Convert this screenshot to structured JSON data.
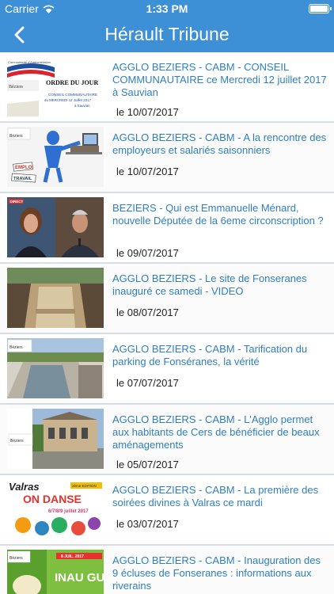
{
  "status_bar": {
    "carrier": "Carrier",
    "time": "1:33 PM"
  },
  "nav": {
    "title": "Hérault Tribune"
  },
  "articles": [
    {
      "headline": "AGGLO BEZIERS - CABM - CONSEIL COMMUNAUTAIRE ce Mercredi 12 juillet 2017 à Sauvian",
      "date": "le 10/07/2017"
    },
    {
      "headline": "AGGLO BEZIERS - CABM - A la rencontre des employeurs et salariés saisonniers",
      "date": "le 10/07/2017"
    },
    {
      "headline": "BEZIERS - Qui est Emmanuelle Ménard, nouvelle Députée de la 6eme circonscription ?",
      "date": "le 09/07/2017"
    },
    {
      "headline": "AGGLO BEZIERS - Le site de Fonseranes inauguré ce samedi - VIDEO",
      "date": "le 08/07/2017"
    },
    {
      "headline": "AGGLO BEZIERS - CABM - Tarification du parking de Fonséranes, la vérité",
      "date": "le 07/07/2017"
    },
    {
      "headline": "AGGLO BEZIERS - CABM - L'Agglo permet aux habitants de Cers de bénéficier de beaux aménagements",
      "date": "le 05/07/2017"
    },
    {
      "headline": "AGGLO BEZIERS - CABM - La première des soirées divines à Valras ce mardi",
      "date": "le 03/07/2017"
    },
    {
      "headline": "AGGLO BEZIERS - CABM - Inauguration des 9 écluses de Fonseranes : informations aux riverains",
      "date": ""
    }
  ],
  "thumb_text": {
    "t1": {
      "agglo": "Communauté d'Agglomération",
      "beziers": "Béziers",
      "title": "ORDRE DU JOUR",
      "line1": "CONSEIL COMMUNAUTAIRE",
      "line2": "du MERCREDI 12 Juillet 2017",
      "line3": "à Sauvian"
    },
    "t2": {
      "beziers": "Béziers",
      "word1": "EMPLOI",
      "word2": "TRAVAIL"
    },
    "t3": {
      "tag": "DIRECT"
    },
    "t5": {
      "beziers": "Béziers"
    },
    "t6": {
      "beziers": "Béziers"
    },
    "t7": {
      "brand": "Valras",
      "word": "ON DANSE",
      "edition": "2ème EDITION",
      "dates": "6/7/8/9 juillet 2017"
    },
    "t8": {
      "beziers": "Béziers",
      "date": "8 JUIL. 2017",
      "big": "INAU GURA"
    }
  },
  "colors": {
    "accent": "#3d8fd6",
    "link": "#2f7fbf"
  }
}
